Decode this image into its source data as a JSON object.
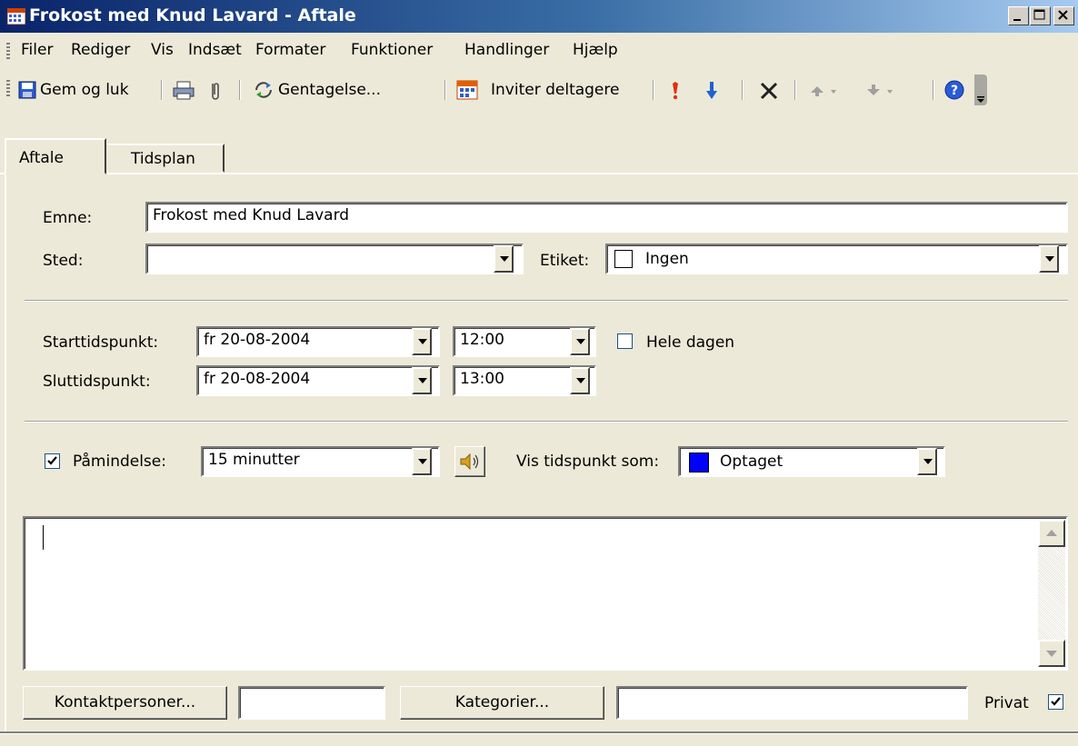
{
  "window": {
    "title": "Frokost med Knud Lavard - Aftale"
  },
  "menu": [
    "Filer",
    "Rediger",
    "Vis",
    "Indsæt",
    "Formater",
    "Funktioner",
    "Handlinger",
    "Hjælp"
  ],
  "toolbar": {
    "save_close": "Gem og luk",
    "recurrence": "Gentagelse...",
    "invite": "Inviter deltagere"
  },
  "tabs": [
    "Aftale",
    "Tidsplan"
  ],
  "form": {
    "subject_label": "Emne:",
    "subject_value": "Frokost med Knud Lavard",
    "location_label": "Sted:",
    "location_value": "",
    "label_label": "Etiket:",
    "label_value": "Ingen",
    "start_label": "Starttidspunkt:",
    "start_date": "fr 20-08-2004",
    "start_time": "12:00",
    "allday_label": "Hele dagen",
    "allday_checked": false,
    "end_label": "Sluttidspunkt:",
    "end_date": "fr 20-08-2004",
    "end_time": "13:00",
    "reminder_label": "Påmindelse:",
    "reminder_checked": true,
    "reminder_value": "15 minutter",
    "show_as_label": "Vis tidspunkt som:",
    "show_as_value": "Optaget",
    "show_as_color": "#0000ff",
    "notes": ""
  },
  "footer": {
    "contacts_button": "Kontaktpersoner...",
    "contacts_value": "",
    "categories_button": "Kategorier...",
    "categories_value": "",
    "private_label": "Privat",
    "private_checked": true
  }
}
